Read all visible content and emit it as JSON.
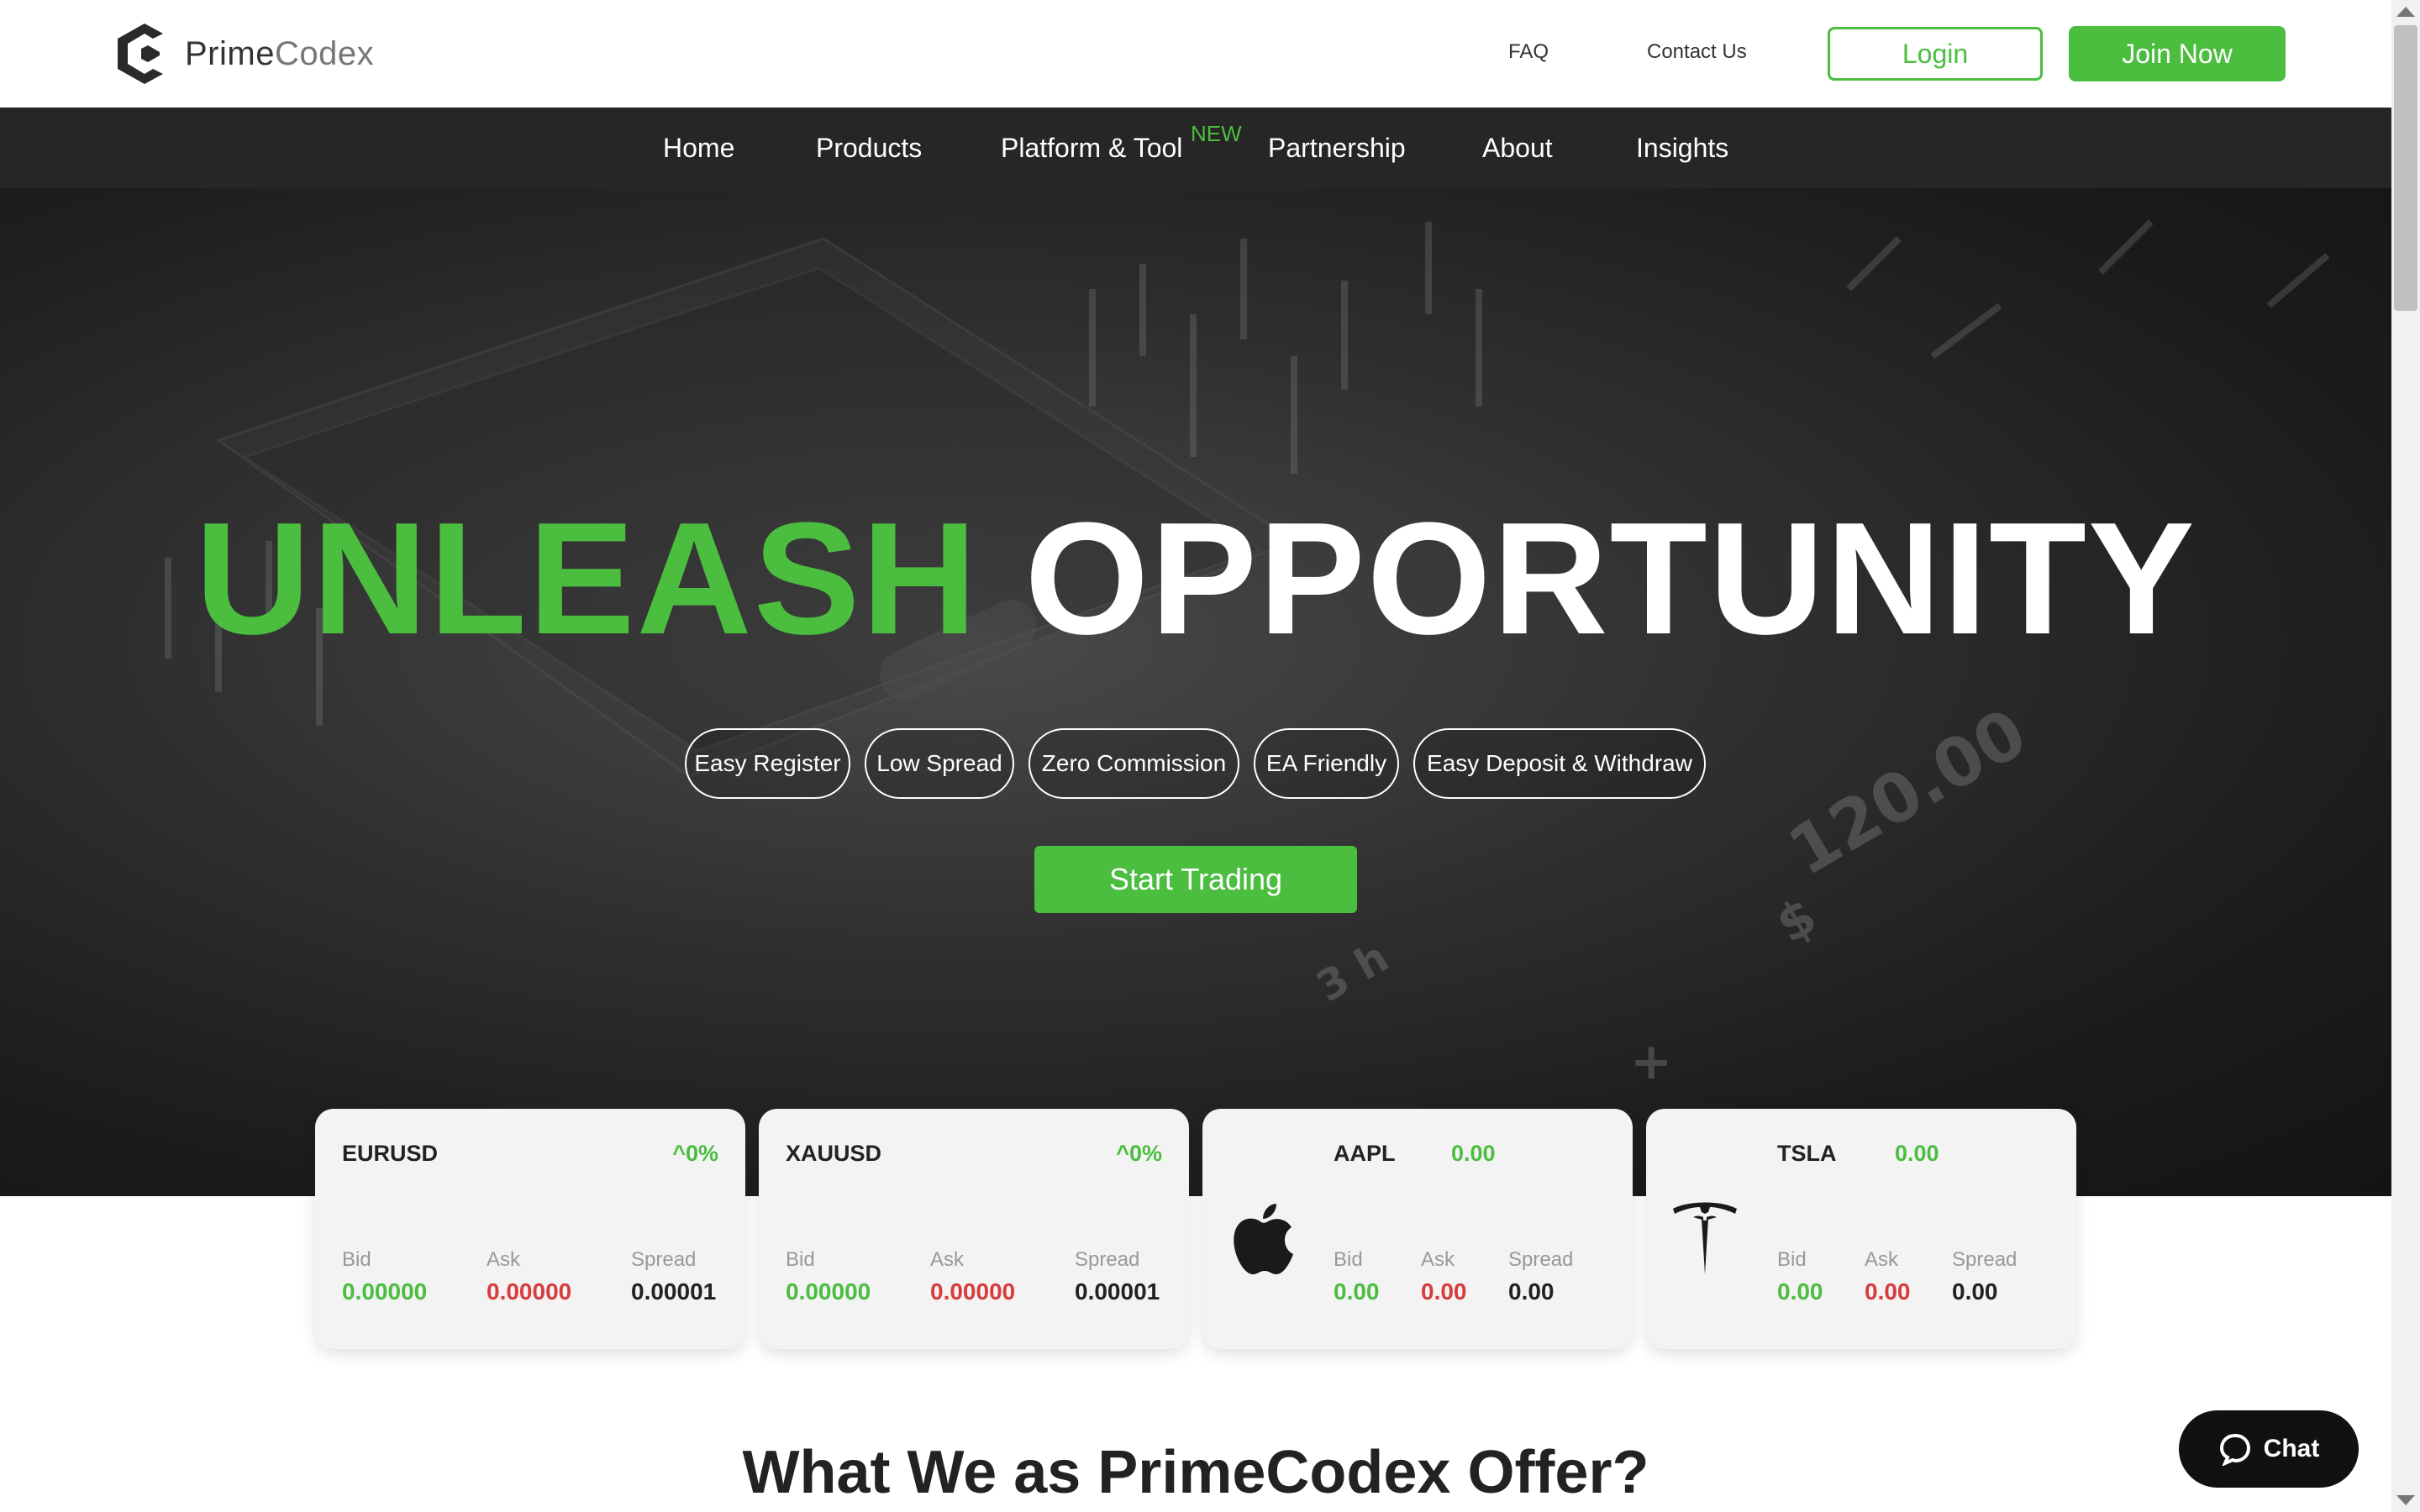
{
  "brand": {
    "name_primary": "Prime",
    "name_secondary": "Codex"
  },
  "header": {
    "links": {
      "faq": "FAQ",
      "contact": "Contact Us"
    },
    "login_label": "Login",
    "join_label": "Join Now"
  },
  "nav": {
    "items": [
      "Home",
      "Products",
      "Platform & Tool",
      "Partnership",
      "About",
      "Insights"
    ],
    "new_badge": "NEW"
  },
  "hero": {
    "headline_green": "UNLEASH",
    "headline_white": "OPPORTUNITY",
    "features": [
      "Easy Register",
      "Low Spread",
      "Zero Commission",
      "EA Friendly",
      "Easy Deposit & Withdraw"
    ],
    "cta_label": "Start Trading"
  },
  "tickers": [
    {
      "symbol": "EURUSD",
      "change": "^0%",
      "bid_label": "Bid",
      "ask_label": "Ask",
      "spread_label": "Spread",
      "bid": "0.00000",
      "ask": "0.00000",
      "spread": "0.00001",
      "icon": ""
    },
    {
      "symbol": "XAUUSD",
      "change": "^0%",
      "bid_label": "Bid",
      "ask_label": "Ask",
      "spread_label": "Spread",
      "bid": "0.00000",
      "ask": "0.00000",
      "spread": "0.00001",
      "icon": ""
    },
    {
      "symbol": "AAPL",
      "change": "0.00",
      "bid_label": "Bid",
      "ask_label": "Ask",
      "spread_label": "Spread",
      "bid": "0.00",
      "ask": "0.00",
      "spread": "0.00",
      "icon": "apple-logo-icon"
    },
    {
      "symbol": "TSLA",
      "change": "0.00",
      "bid_label": "Bid",
      "ask_label": "Ask",
      "spread_label": "Spread",
      "bid": "0.00",
      "ask": "0.00",
      "spread": "0.00",
      "icon": "tesla-logo-icon"
    }
  ],
  "section": {
    "title": "What We as PrimeCodex Offer?"
  },
  "chat": {
    "label": "Chat"
  },
  "colors": {
    "accent": "#4bbd3f",
    "ask_red": "#d83b3b",
    "nav_bg": "#262626",
    "dark": "#111111"
  }
}
